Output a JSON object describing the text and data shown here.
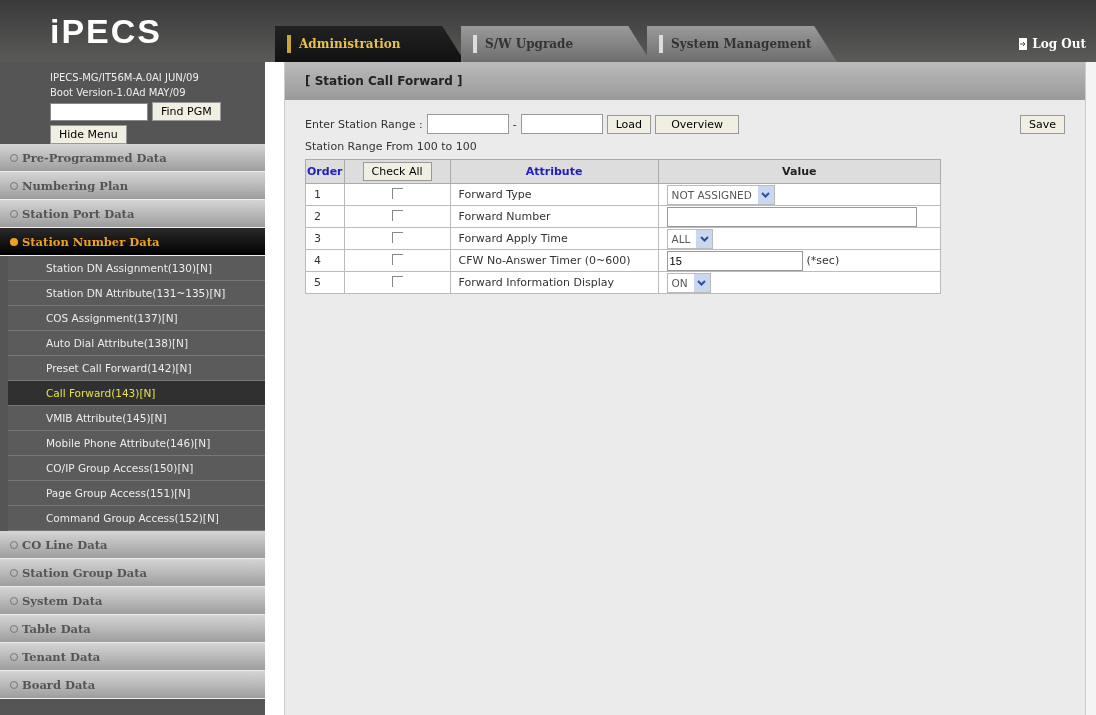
{
  "header": {
    "logo": "iPECS",
    "tabs": [
      {
        "label": "Administration",
        "selected": true
      },
      {
        "label": "S/W Upgrade",
        "selected": false
      },
      {
        "label": "System Management",
        "selected": false
      }
    ],
    "logout": "Log Out"
  },
  "sidebar": {
    "version_lines": [
      "IPECS-MG/IT56M-A.0AI JUN/09",
      "Boot Version-1.0Ad MAY/09"
    ],
    "find_button": "Find PGM",
    "hide_button": "Hide Menu",
    "sections": [
      {
        "label": "Pre-Programmed Data",
        "expanded": false
      },
      {
        "label": "Numbering Plan",
        "expanded": false
      },
      {
        "label": "Station Port Data",
        "expanded": false
      },
      {
        "label": "Station Number Data",
        "expanded": true,
        "children": [
          {
            "label": "Station DN Assignment(130)[N]",
            "selected": false
          },
          {
            "label": "Station DN Attribute(131~135)[N]",
            "selected": false
          },
          {
            "label": "COS Assignment(137)[N]",
            "selected": false
          },
          {
            "label": "Auto Dial Attribute(138)[N]",
            "selected": false
          },
          {
            "label": "Preset Call Forward(142)[N]",
            "selected": false
          },
          {
            "label": "Call Forward(143)[N]",
            "selected": true
          },
          {
            "label": "VMIB Attribute(145)[N]",
            "selected": false
          },
          {
            "label": "Mobile Phone Attribute(146)[N]",
            "selected": false
          },
          {
            "label": "CO/IP Group Access(150)[N]",
            "selected": false
          },
          {
            "label": "Page Group Access(151)[N]",
            "selected": false
          },
          {
            "label": "Command Group Access(152)[N]",
            "selected": false
          }
        ]
      },
      {
        "label": "CO Line Data",
        "expanded": false
      },
      {
        "label": "Station Group Data",
        "expanded": false
      },
      {
        "label": "System Data",
        "expanded": false
      },
      {
        "label": "Table Data",
        "expanded": false
      },
      {
        "label": "Tenant Data",
        "expanded": false
      },
      {
        "label": "Board Data",
        "expanded": false
      }
    ]
  },
  "content": {
    "title": "[ Station Call Forward ]",
    "range_label": "Enter Station Range :",
    "range_separator": "-",
    "load_button": "Load",
    "overview_button": "Overview",
    "save_button": "Save",
    "range_info": "Station Range From 100 to 100",
    "table": {
      "columns": [
        "Order",
        "Check All",
        "Attribute",
        "Value"
      ],
      "rows": [
        {
          "order": "1",
          "checked": false,
          "attribute": "Forward Type",
          "kind": "select",
          "value": "NOT ASSIGNED"
        },
        {
          "order": "2",
          "checked": false,
          "attribute": "Forward Number",
          "kind": "wide_input"
        },
        {
          "order": "3",
          "checked": false,
          "attribute": "Forward Apply Time",
          "kind": "select",
          "value": "ALL"
        },
        {
          "order": "4",
          "checked": false,
          "attribute": "CFW No-Answer Timer (0~600)",
          "kind": "input",
          "value": "15",
          "unit": "(*sec)"
        },
        {
          "order": "5",
          "checked": false,
          "attribute": "Forward Information Display",
          "kind": "select",
          "value": "ON"
        }
      ]
    }
  }
}
